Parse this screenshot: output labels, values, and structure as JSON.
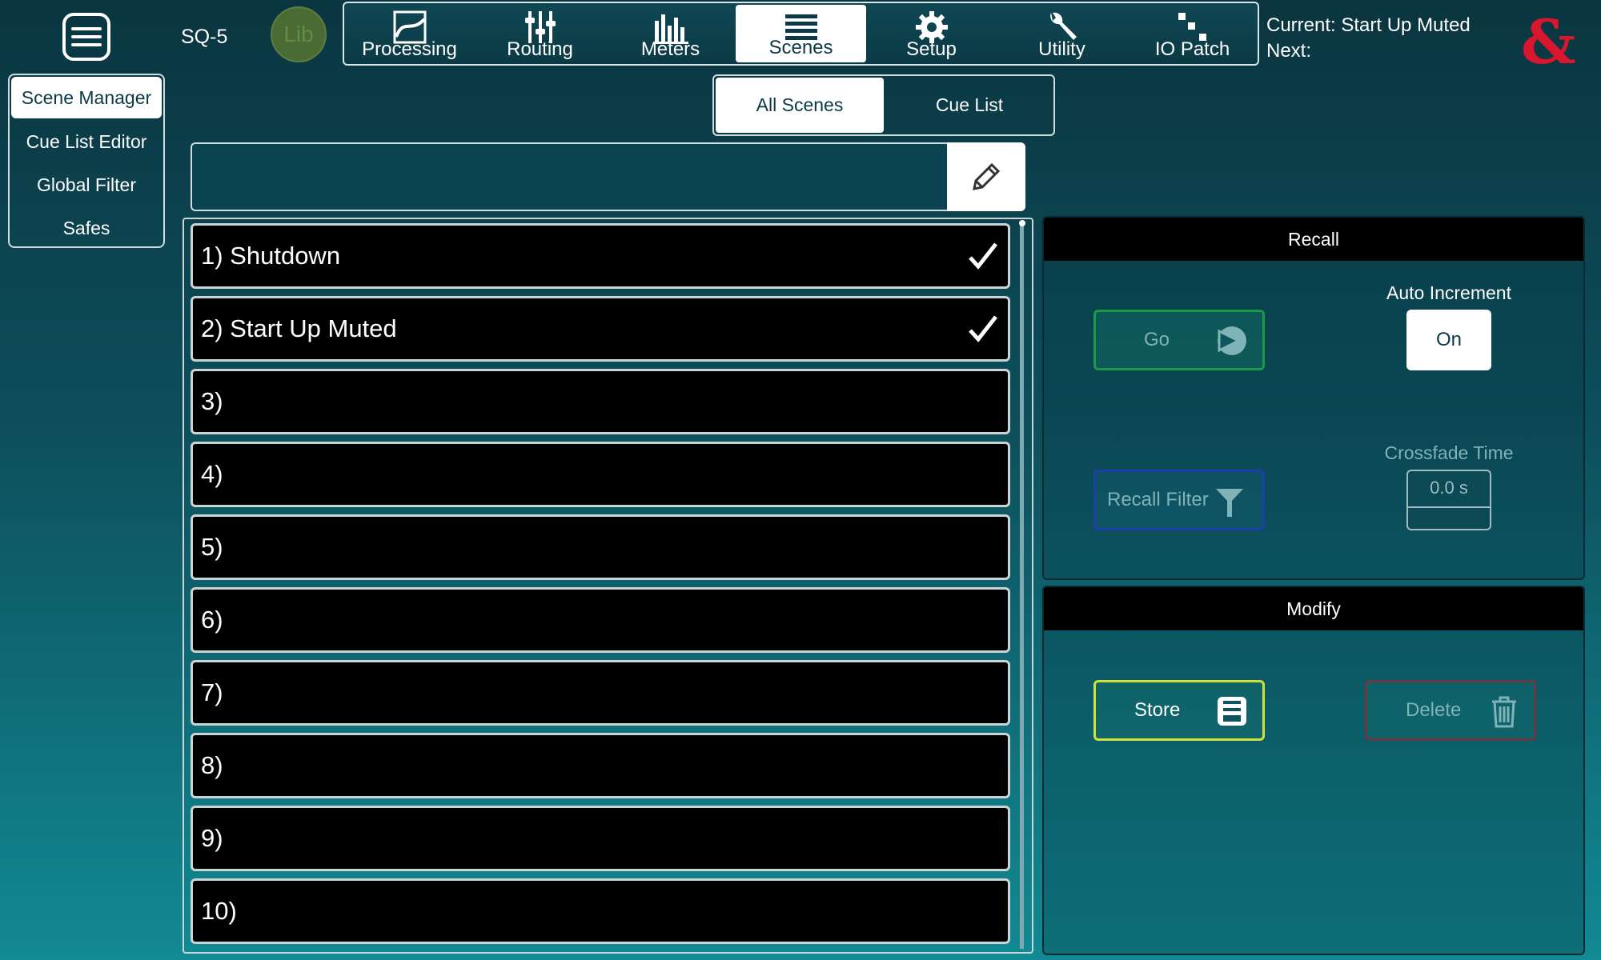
{
  "header": {
    "device": "SQ-5",
    "lib_label": "Lib",
    "tabs": [
      {
        "label": "Processing",
        "icon": "processing-icon"
      },
      {
        "label": "Routing",
        "icon": "routing-icon"
      },
      {
        "label": "Meters",
        "icon": "meters-icon"
      },
      {
        "label": "Scenes",
        "icon": "scenes-icon",
        "active": true
      },
      {
        "label": "Setup",
        "icon": "gear-icon"
      },
      {
        "label": "Utility",
        "icon": "wrench-icon"
      },
      {
        "label": "IO Patch",
        "icon": "io-patch-icon"
      }
    ],
    "current": "Current: Start Up Muted",
    "next": "Next:",
    "logo": "&"
  },
  "sidebar": {
    "items": [
      {
        "label": "Scene Manager",
        "active": true
      },
      {
        "label": "Cue List Editor"
      },
      {
        "label": "Global Filter"
      },
      {
        "label": "Safes"
      }
    ]
  },
  "mode_toggle": {
    "all_scenes": "All Scenes",
    "cue_list": "Cue List",
    "selected": "All Scenes"
  },
  "name_field": {
    "value": ""
  },
  "scenes": [
    {
      "label": "1) Shutdown",
      "checked": true
    },
    {
      "label": "2) Start Up Muted",
      "checked": true
    },
    {
      "label": "3)",
      "checked": false
    },
    {
      "label": "4)",
      "checked": false
    },
    {
      "label": "5)",
      "checked": false
    },
    {
      "label": "6)",
      "checked": false
    },
    {
      "label": "7)",
      "checked": false
    },
    {
      "label": "8)",
      "checked": false
    },
    {
      "label": "9)",
      "checked": false
    },
    {
      "label": "10)",
      "checked": false
    }
  ],
  "recall": {
    "title": "Recall",
    "go_label": "Go",
    "auto_increment_label": "Auto Increment",
    "auto_increment_value": "On",
    "recall_filter_label": "Recall Filter",
    "crossfade_label": "Crossfade Time",
    "crossfade_value": "0.0 s"
  },
  "modify": {
    "title": "Modify",
    "store_label": "Store",
    "delete_label": "Delete"
  },
  "colors": {
    "go_border": "#1a9a45",
    "filter_border": "#1d3fae",
    "store_border": "#d2e03a",
    "delete_border": "#6a3a40",
    "logo": "#d8162e"
  }
}
